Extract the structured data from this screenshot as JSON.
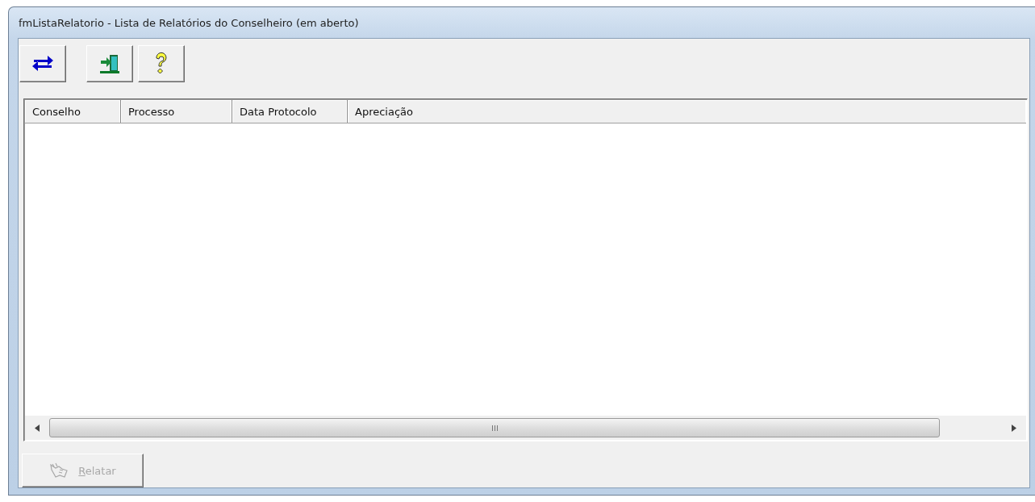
{
  "window": {
    "title": "fmListaRelatorio - Lista de Relatórios do Conselheiro (em aberto)"
  },
  "toolbar": [
    {
      "kind": "swap"
    },
    {
      "kind": "exit"
    },
    {
      "kind": "help"
    }
  ],
  "table": {
    "columns": [
      "Conselho",
      "Processo",
      "Data Protocolo",
      "Apreciação"
    ]
  },
  "buttons": [
    {
      "label": "Relatar",
      "disabled": true
    }
  ]
}
